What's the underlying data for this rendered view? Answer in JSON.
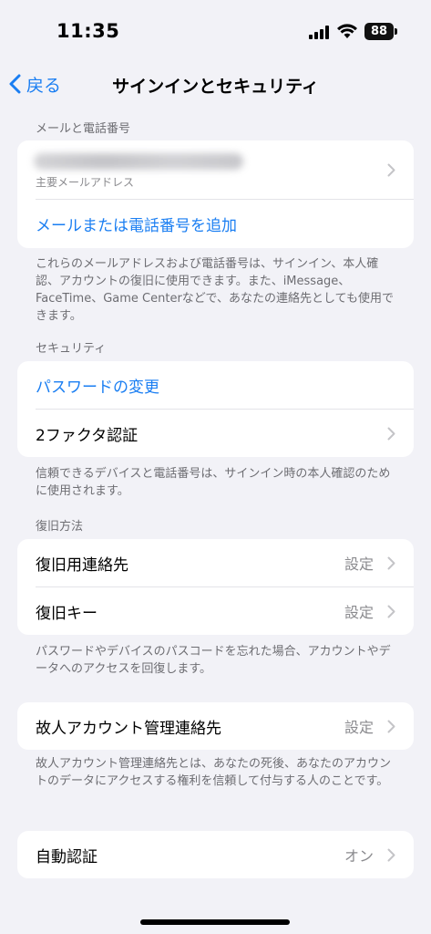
{
  "status": {
    "time": "11:35",
    "battery": "88"
  },
  "nav": {
    "back_label": "戻る",
    "title": "サインインとセキュリティ"
  },
  "email_section": {
    "header": "メールと電話番号",
    "primary_email_label": "主要メールアドレス",
    "add_label": "メールまたは電話番号を追加",
    "footer": "これらのメールアドレスおよび電話番号は、サインイン、本人確認、アカウントの復旧に使用できます。また、iMessage、FaceTime、Game Centerなどで、あなたの連絡先としても使用できます。"
  },
  "security_section": {
    "header": "セキュリティ",
    "change_password_label": "パスワードの変更",
    "two_factor_label": "2ファクタ認証",
    "footer": "信頼できるデバイスと電話番号は、サインイン時の本人確認のために使用されます。"
  },
  "recovery_section": {
    "header": "復旧方法",
    "recovery_contact_label": "復旧用連絡先",
    "recovery_contact_value": "設定",
    "recovery_key_label": "復旧キー",
    "recovery_key_value": "設定",
    "footer": "パスワードやデバイスのパスコードを忘れた場合、アカウントやデータへのアクセスを回復します。"
  },
  "legacy_section": {
    "legacy_contact_label": "故人アカウント管理連絡先",
    "legacy_contact_value": "設定",
    "footer": "故人アカウント管理連絡先とは、あなたの死後、あなたのアカウントのデータにアクセスする権利を信頼して付与する人のことです。"
  },
  "auto_verify_section": {
    "label": "自動認証",
    "value": "オン"
  },
  "colors": {
    "accent": "#1a7ef2",
    "background": "#f2f2f7",
    "secondary_text": "#6d6d72"
  },
  "icons": [
    "back-chevron-icon",
    "chevron-right-icon",
    "wifi-icon",
    "signal-icon",
    "battery-icon"
  ]
}
